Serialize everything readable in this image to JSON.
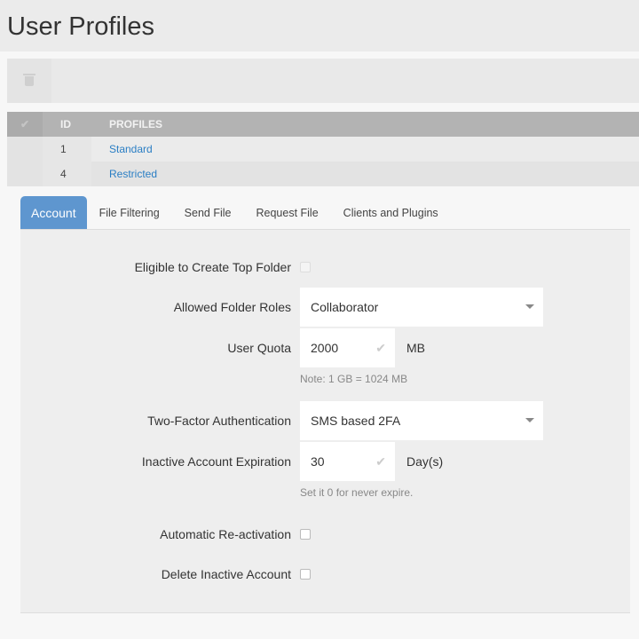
{
  "page": {
    "title": "User Profiles"
  },
  "toolbar": {
    "delete_icon": "trash-icon"
  },
  "table": {
    "headers": {
      "select": "✔",
      "id": "ID",
      "profiles": "PROFILES"
    },
    "rows": [
      {
        "id": "1",
        "name": "Standard"
      },
      {
        "id": "4",
        "name": "Restricted"
      }
    ]
  },
  "tabs": [
    {
      "label": "Account",
      "active": true
    },
    {
      "label": "File Filtering"
    },
    {
      "label": "Send File"
    },
    {
      "label": "Request File"
    },
    {
      "label": "Clients and Plugins"
    }
  ],
  "form": {
    "top_folder": {
      "label": "Eligible to Create Top Folder",
      "checked": false
    },
    "folder_roles": {
      "label": "Allowed Folder Roles",
      "value": "Collaborator"
    },
    "quota": {
      "label": "User Quota",
      "value": "2000",
      "unit": "MB",
      "note": "Note: 1 GB = 1024 MB"
    },
    "two_factor": {
      "label": "Two-Factor Authentication",
      "value": "SMS based 2FA"
    },
    "expiration": {
      "label": "Inactive Account Expiration",
      "value": "30",
      "unit": "Day(s)",
      "note": "Set it 0 for never expire."
    },
    "reactivation": {
      "label": "Automatic Re-activation",
      "checked": false
    },
    "delete_inactive": {
      "label": "Delete Inactive Account",
      "checked": false
    }
  },
  "colors": {
    "accent": "#5e96cf",
    "link": "#2a7ec4"
  }
}
